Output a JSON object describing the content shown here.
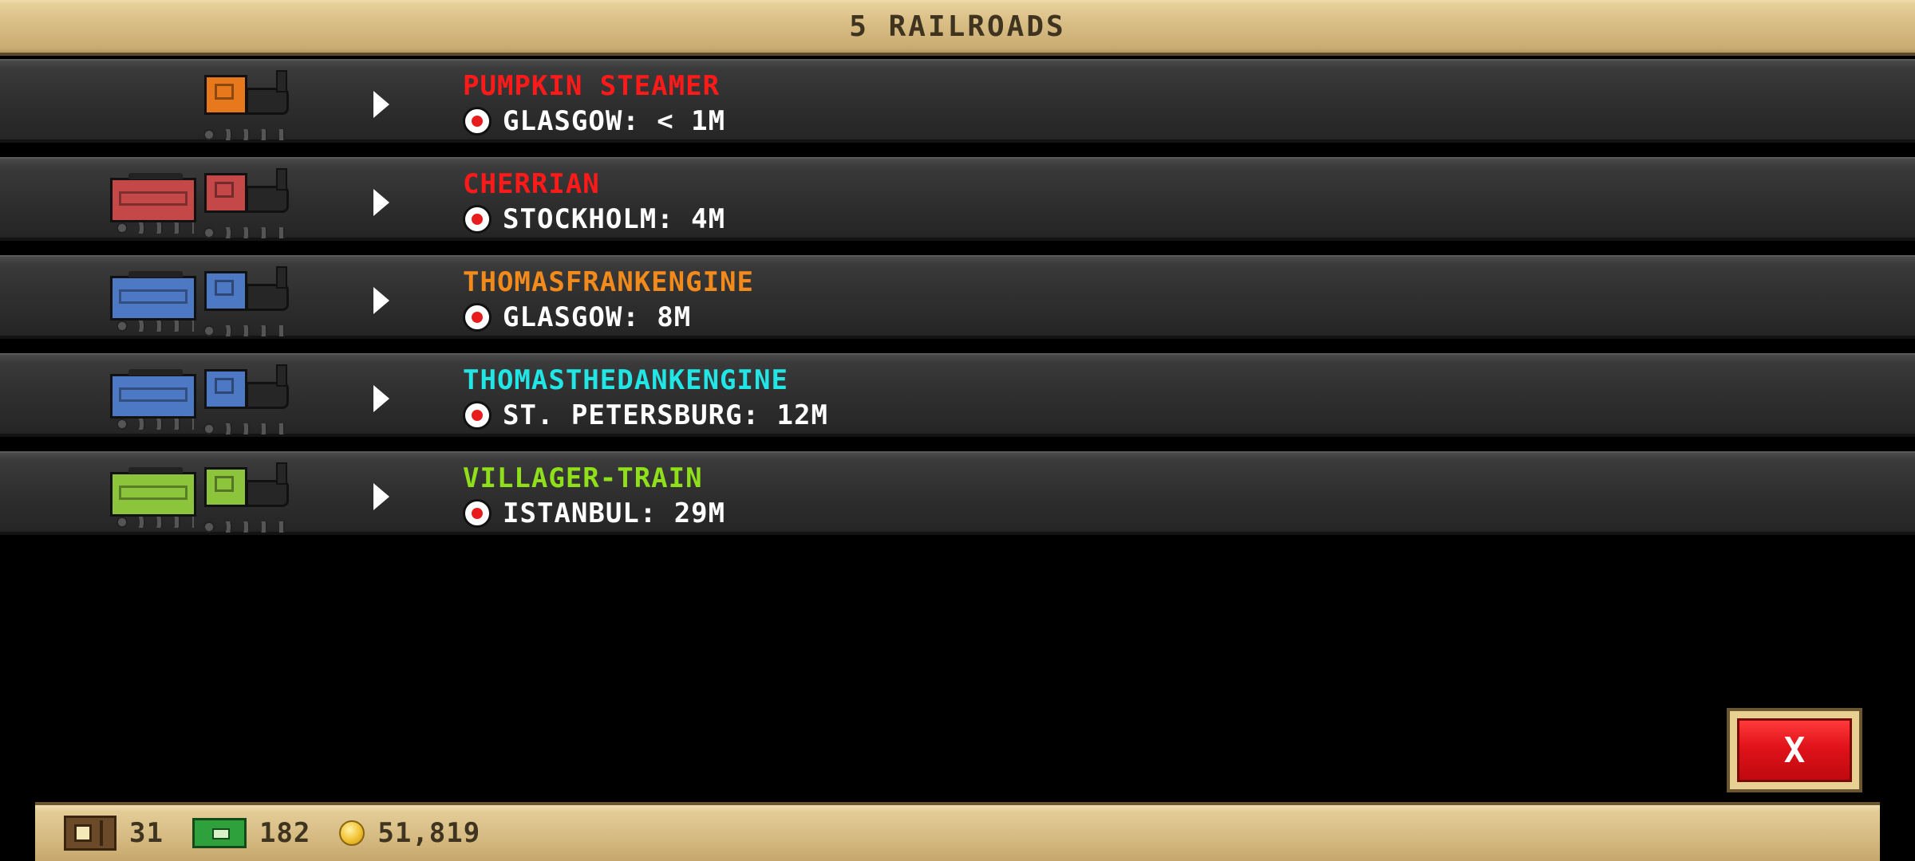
{
  "header": {
    "title": "5 RAILROADS"
  },
  "railroads": [
    {
      "name": "PUMPKIN STEAMER",
      "name_color": "#ff1a1a",
      "station": "GLASGOW: < 1M",
      "train_color": "#e8781c",
      "has_tender": false
    },
    {
      "name": "CHERRIAN",
      "name_color": "#ff1a1a",
      "station": "STOCKHOLM: 4M",
      "train_color": "#c44848",
      "has_tender": true
    },
    {
      "name": "THOMASFRANKENGINE",
      "name_color": "#f28a1c",
      "station": "GLASGOW: 8M",
      "train_color": "#4d78c4",
      "has_tender": true
    },
    {
      "name": "THOMASTHEDANKENGINE",
      "name_color": "#22e6e6",
      "station": "ST. PETERSBURG: 12M",
      "train_color": "#4d78c4",
      "has_tender": true
    },
    {
      "name": "VILLAGER-TRAIN",
      "name_color": "#8fe01a",
      "station": "ISTANBUL: 29M",
      "train_color": "#8cc43c",
      "has_tender": true
    }
  ],
  "close_button": {
    "label": "X"
  },
  "footer": {
    "tickets": "31",
    "cash": "182",
    "coins": "51,819"
  }
}
